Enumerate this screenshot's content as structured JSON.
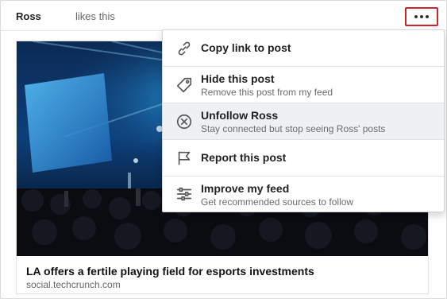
{
  "post": {
    "author": "Ross",
    "action": "likes this"
  },
  "article": {
    "title": "LA offers a fertile playing field for esports investments",
    "source": "social.techcrunch.com"
  },
  "menu": {
    "items": [
      {
        "label": "Copy link to post",
        "icon": "link-icon"
      },
      {
        "label": "Hide this post",
        "sub": "Remove this post from my feed",
        "icon": "tag-icon"
      },
      {
        "label": "Unfollow Ross",
        "sub": "Stay connected but stop seeing Ross' posts",
        "icon": "unfollow-x-icon",
        "highlighted": true
      },
      {
        "label": "Report this post",
        "icon": "flag-icon"
      },
      {
        "label": "Improve my feed",
        "sub": "Get recommended sources to follow",
        "icon": "sliders-icon"
      }
    ]
  },
  "colors": {
    "more_button_border": "#d0242b",
    "menu_highlight": "#eef1f4"
  }
}
